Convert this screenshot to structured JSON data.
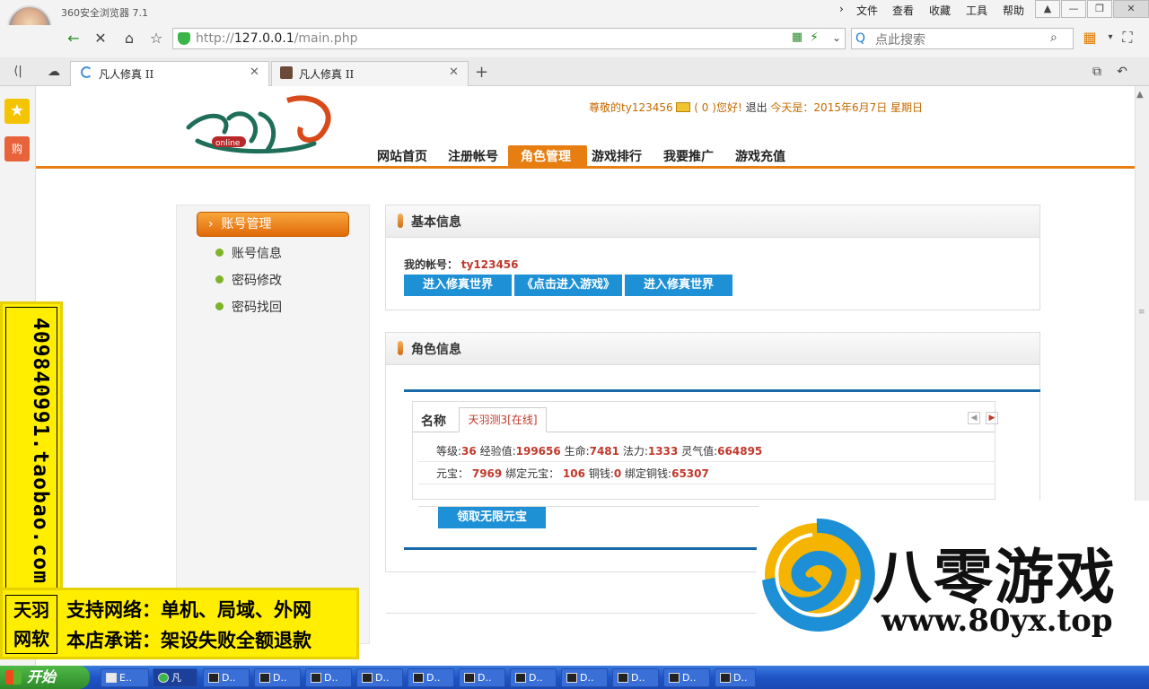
{
  "browser": {
    "title": "360安全浏览器 7.1",
    "menu": [
      "文件",
      "查看",
      "收藏",
      "工具",
      "帮助"
    ],
    "url_prefix": "http://",
    "url_host": "127.0.0.1",
    "url_path": "/main.php",
    "search_placeholder": "点此搜索",
    "tabs": [
      {
        "label": "凡人修真 II",
        "active": true
      },
      {
        "label": "凡人修真 II",
        "active": false
      }
    ],
    "new_tab": "+"
  },
  "header": {
    "greeting_prefix": "尊敬的",
    "username": "ty123456",
    "mail_count": "( 0 )",
    "greeting_suffix": "您好!",
    "logout": "退出",
    "today_label": "今天是：2015年6月7日 星期日",
    "nav": [
      "网站首页",
      "注册帐号",
      "角色管理",
      "游戏排行",
      "我要推广",
      "游戏充值"
    ],
    "active_nav": "角色管理"
  },
  "sidebar": {
    "heading": "账号管理",
    "items": [
      "账号信息",
      "密码修改",
      "密码找回"
    ]
  },
  "basic_info": {
    "title": "基本信息",
    "account_label": "我的帐号：",
    "account_value": "ty123456",
    "buttons": [
      "进入修真世界",
      "《点击进入游戏》",
      "进入修真世界"
    ]
  },
  "role_info": {
    "title": "角色信息",
    "name_label": "名称",
    "role_tab": "天羽测3[在线]",
    "stats_row1": [
      {
        "label": "等级:",
        "value": "36"
      },
      {
        "label": "经验值:",
        "value": "199656"
      },
      {
        "label": "生命:",
        "value": "7481"
      },
      {
        "label": "法力:",
        "value": "1333"
      },
      {
        "label": "灵气值:",
        "value": "664895"
      }
    ],
    "stats_row2": [
      {
        "label": "元宝：",
        "value": "7969"
      },
      {
        "label": "绑定元宝：",
        "value": "106"
      },
      {
        "label": "铜钱:",
        "value": "0"
      },
      {
        "label": "绑定铜钱:",
        "value": "65307"
      }
    ],
    "claim_button": "领取无限元宝"
  },
  "ad": {
    "vertical_text": "409840991.taobao.com",
    "brand_line1": "天羽",
    "brand_line2": "网软",
    "line1": "支持网络：单机、局域、外网",
    "line2": "本店承诺：架设失败全额退款"
  },
  "watermark": {
    "name": "八零游戏",
    "url": "www.80yx.top"
  },
  "taskbar": {
    "start": "开始",
    "items": [
      "E..",
      "凡",
      "D..",
      "D..",
      "D..",
      "D..",
      "D..",
      "D..",
      "D..",
      "D..",
      "D..",
      "D..",
      "D.."
    ]
  },
  "colors": {
    "accent_orange": "#e67e12",
    "button_blue": "#1e90d6",
    "value_red": "#c0392b"
  }
}
